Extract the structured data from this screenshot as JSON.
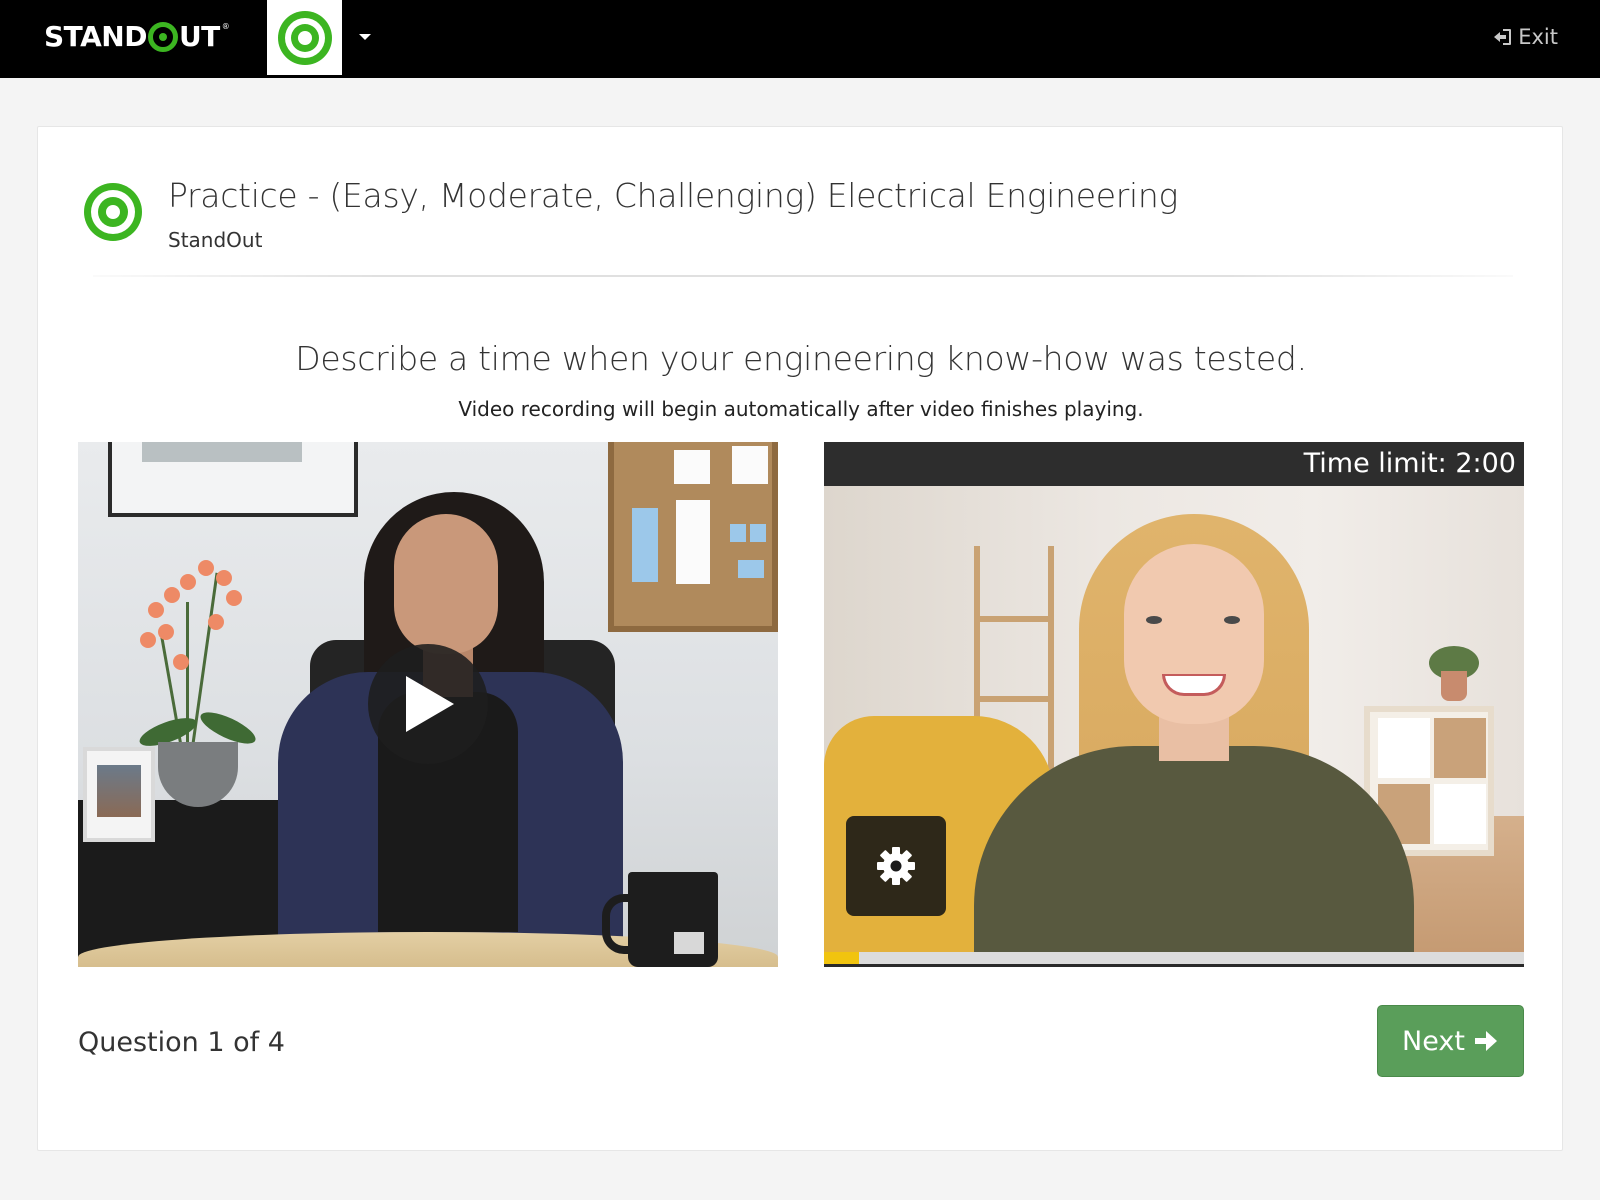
{
  "header": {
    "brand_prefix": "STAND",
    "brand_suffix": "UT",
    "brand_mark": "®",
    "org_icon": "target-logo-icon",
    "exit_label": "Exit",
    "accent_color": "#3cb521"
  },
  "assessment": {
    "title": "Practice - (Easy, Moderate, Challenging) Electrical Engineering",
    "organization": "StandOut",
    "question_text": "Describe a time when your engineering know-how was tested.",
    "instruction": "Video recording will begin automatically after video finishes playing."
  },
  "recorder": {
    "time_limit_label": "Time limit: 2:00",
    "progress": 0.05,
    "progress_color": "#f1c40f"
  },
  "footer": {
    "question_counter": "Question 1 of 4",
    "next_label": "Next",
    "next_color": "#5a9e5a"
  }
}
